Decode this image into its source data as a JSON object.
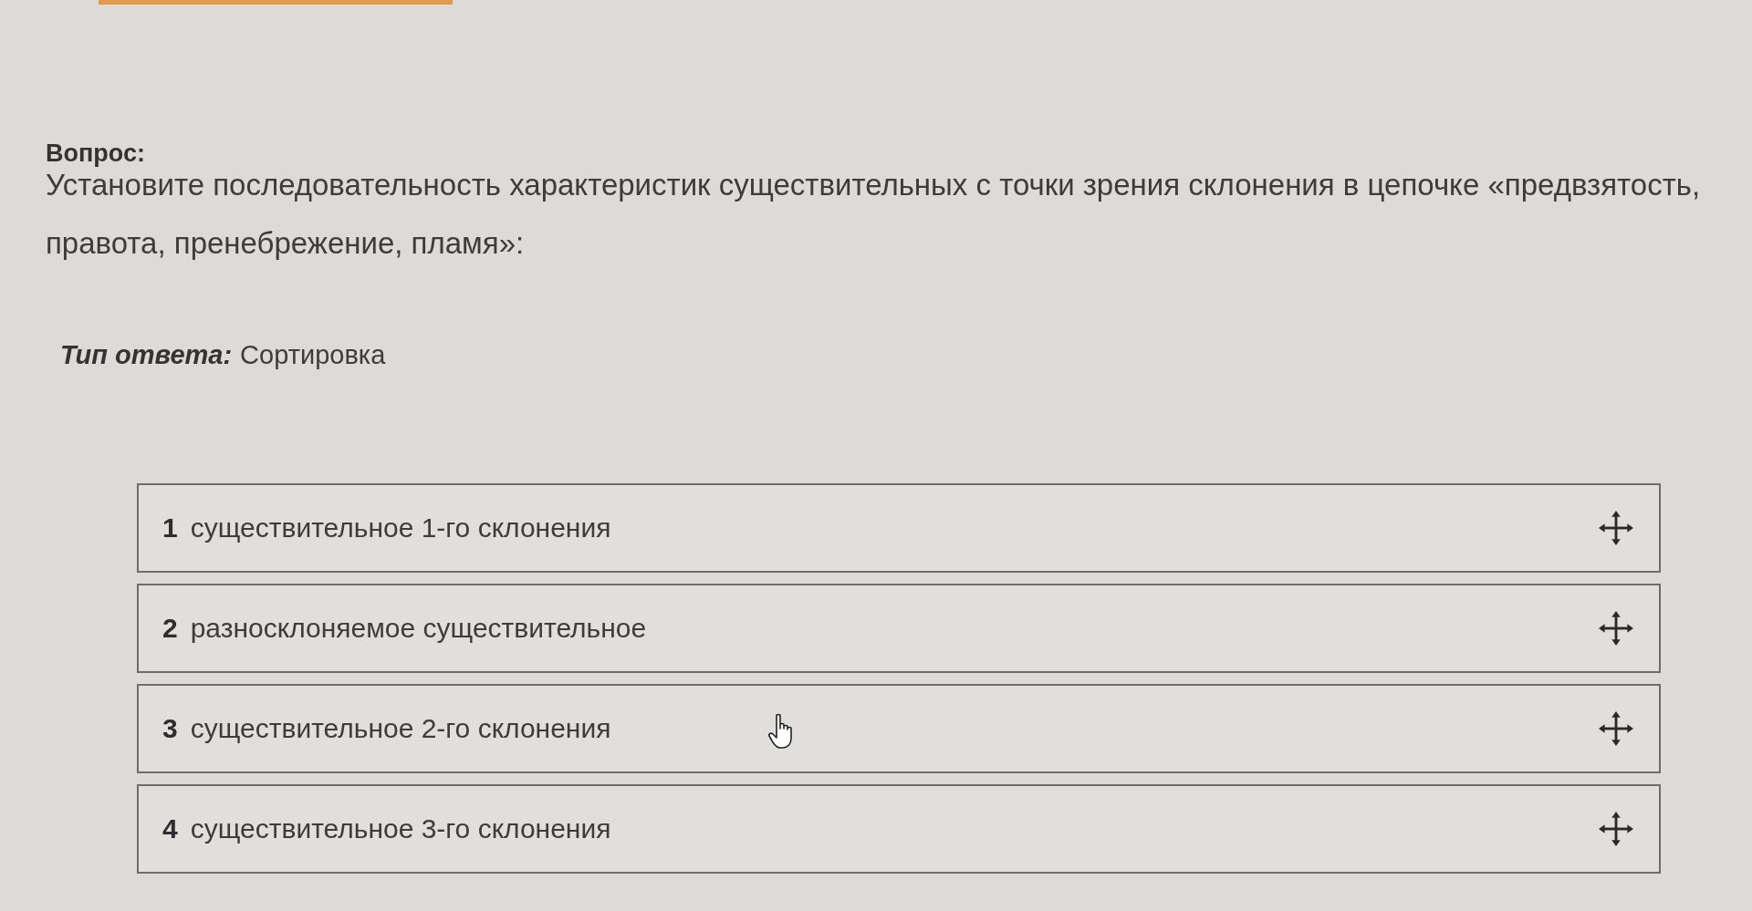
{
  "question": {
    "label": "Вопрос:",
    "text": "Установите последовательность характеристик существительных с точки зрения склонения в цепочке «предвзятость, правота, пренебрежение, пламя»:"
  },
  "answer_type": {
    "label": "Тип ответа:",
    "value": "Сортировка"
  },
  "items": [
    {
      "number": "1",
      "text": "существительное 1-го склонения"
    },
    {
      "number": "2",
      "text": "разносклоняемое существительное"
    },
    {
      "number": "3",
      "text": "существительное 2-го склонения"
    },
    {
      "number": "4",
      "text": "существительное 3-го склонения"
    }
  ]
}
